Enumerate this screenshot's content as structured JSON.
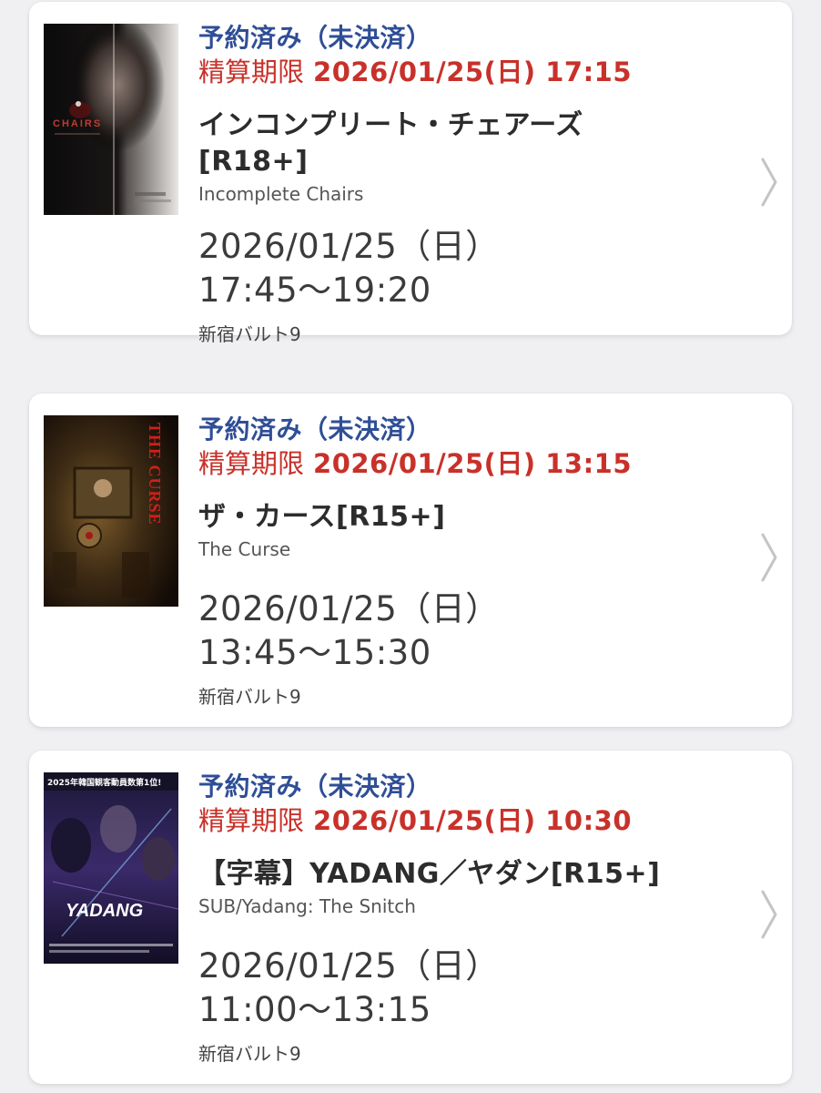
{
  "reservations": [
    {
      "status": "予約済み（未決済）",
      "deadline_label": "精算期限",
      "deadline_value": "2026/01/25(日) 17:15",
      "title": "インコンプリート・チェアーズ[R18+]",
      "subtitle": "Incomplete Chairs",
      "date": "2026/01/25（日）",
      "time": "17:45〜19:20",
      "theater": "新宿バルト9",
      "poster_text": "CHAIRS"
    },
    {
      "status": "予約済み（未決済）",
      "deadline_label": "精算期限",
      "deadline_value": "2026/01/25(日) 13:15",
      "title": "ザ・カース[R15+]",
      "subtitle": "The Curse",
      "date": "2026/01/25（日）",
      "time": "13:45〜15:30",
      "theater": "新宿バルト9",
      "poster_text": "THE CURSE"
    },
    {
      "status": "予約済み（未決済）",
      "deadline_label": "精算期限",
      "deadline_value": "2026/01/25(日) 10:30",
      "title": "【字幕】YADANG／ヤダン[R15+]",
      "subtitle": "SUB/Yadang: The Snitch",
      "date": "2026/01/25（日）",
      "time": "11:00〜13:15",
      "theater": "新宿バルト9",
      "poster_text": "YADANG",
      "poster_banner": "2025年韓国観客動員数第1位!"
    }
  ],
  "icons": {
    "chevron": "chevron-right-icon"
  },
  "colors": {
    "status": "#2f4e96",
    "deadline": "#c8312a",
    "background": "#f0f0f2"
  }
}
